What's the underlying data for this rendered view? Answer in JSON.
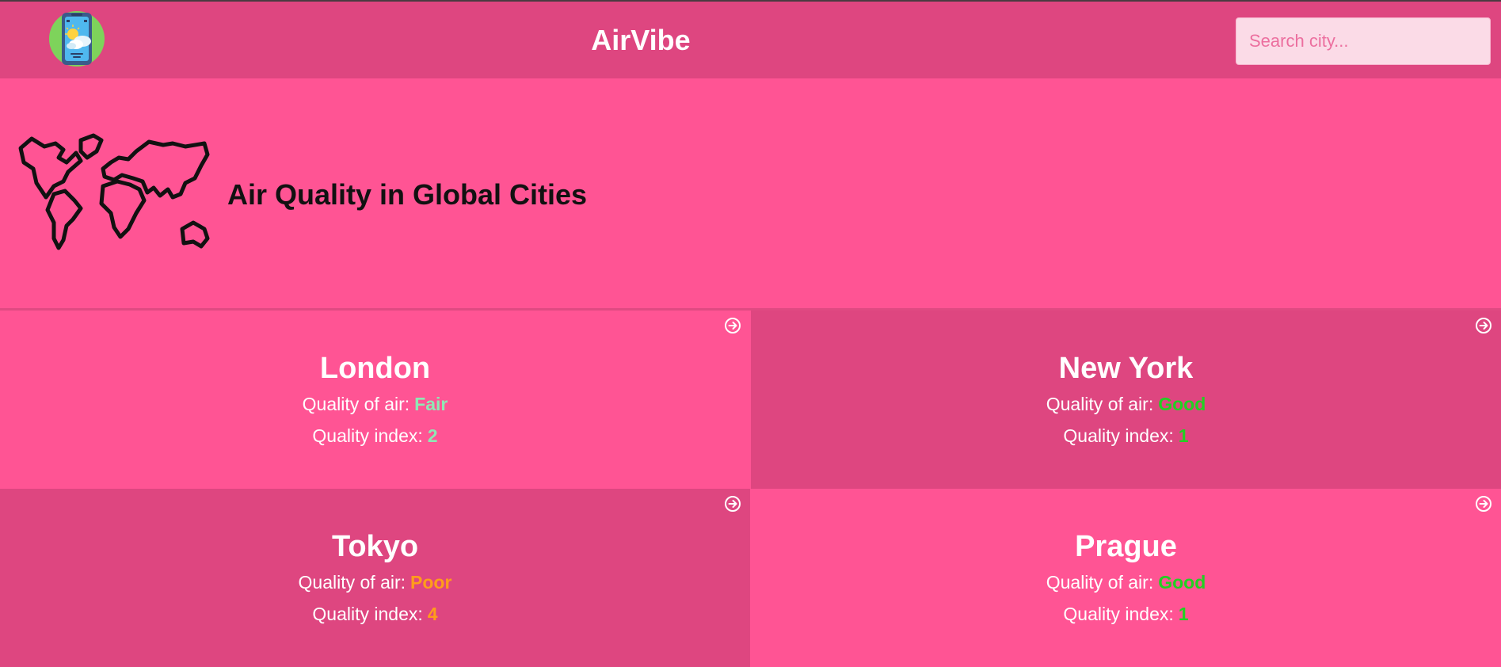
{
  "header": {
    "title": "AirVibe",
    "search_placeholder": "Search city..."
  },
  "hero": {
    "title": "Air Quality in Global Cities"
  },
  "labels": {
    "quality_of_air": "Quality of air:",
    "quality_index": "Quality index:"
  },
  "cities": [
    {
      "name": "London",
      "quality": "Fair",
      "index": "2",
      "color": "#8fe8b4"
    },
    {
      "name": "New York",
      "quality": "Good",
      "index": "1",
      "color": "#22d022"
    },
    {
      "name": "Tokyo",
      "quality": "Poor",
      "index": "4",
      "color": "#ff9d1a"
    },
    {
      "name": "Prague",
      "quality": "Good",
      "index": "1",
      "color": "#22d022"
    }
  ],
  "icons": {
    "logo": "weather-phone-icon",
    "hero": "world-map-icon",
    "card_link": "arrow-right-circle-icon"
  }
}
